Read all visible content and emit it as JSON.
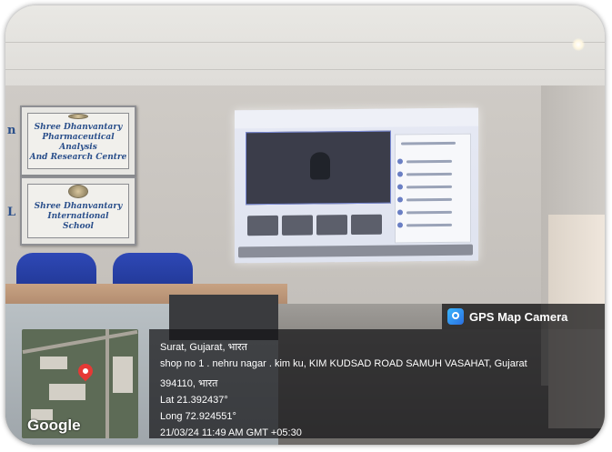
{
  "boards": [
    {
      "lines": [
        "Shree Dhanvantary",
        "Pharmaceutical Analysis",
        "And Research Centre"
      ]
    },
    {
      "lines": [
        "Shree Dhanvantary",
        "International",
        "School"
      ]
    }
  ],
  "edge_letters": [
    "n",
    "L"
  ],
  "badge": {
    "label": "GPS Map Camera",
    "icon": "camera-pin-icon"
  },
  "map": {
    "label": "Google",
    "icon": "location-pin-icon"
  },
  "info": {
    "city": "Surat, Gujarat, भारत",
    "address": "shop no 1 . nehru nagar . kim ku, KIM KUDSAD ROAD SAMUH VASAHAT, Gujarat",
    "postal": "394110, भारत",
    "lat": "Lat 21.392437°",
    "long": "Long 72.924551°",
    "datetime": "21/03/24 11:49 AM GMT +05:30"
  }
}
